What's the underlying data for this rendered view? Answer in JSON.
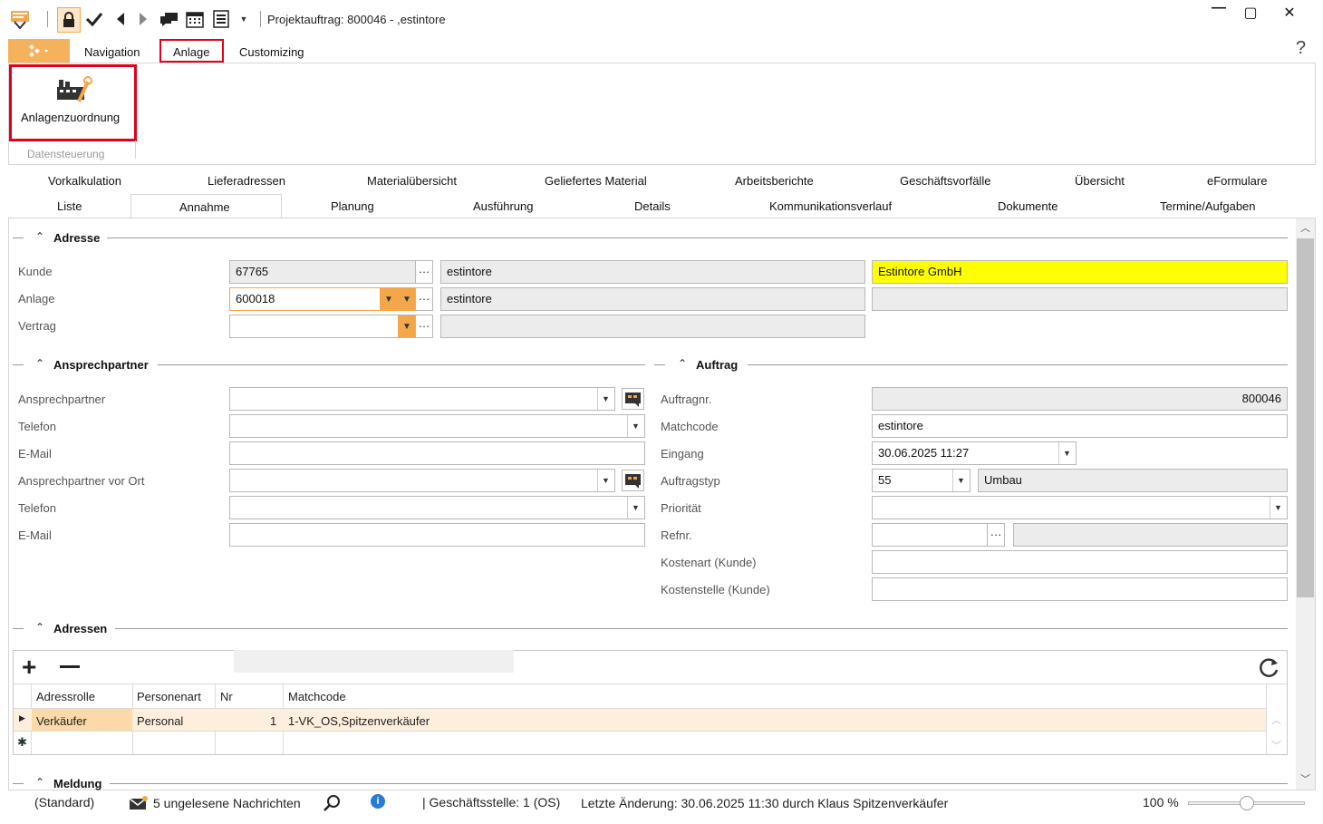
{
  "window": {
    "title": "Projektauftrag: 800046 - ,estintore",
    "minimize": "—",
    "maximize": "▢",
    "close": "✕"
  },
  "toolbar_icons": [
    "app-logo-icon",
    "lock-icon",
    "check-icon",
    "back-icon",
    "forward-icon",
    "chat-icon",
    "calendar-icon",
    "list-icon",
    "dropdown-icon"
  ],
  "menu": {
    "navigation": "Navigation",
    "anlage": "Anlage",
    "customizing": "Customizing",
    "help": "?"
  },
  "ribbon": {
    "button_label": "Anlagenzuordnung",
    "group_label": "Datensteuerung"
  },
  "tabs_row1": [
    "Vorkalkulation",
    "Lieferadressen",
    "Materialübersicht",
    "Geliefertes Material",
    "Arbeitsberichte",
    "Geschäftsvorfälle",
    "Übersicht",
    "eFormulare"
  ],
  "tabs_row2": [
    "Liste",
    "Annahme",
    "Planung",
    "Ausführung",
    "Details",
    "Kommunikationsverlauf",
    "Dokumente",
    "Termine/Aufgaben"
  ],
  "adresse": {
    "title": "Adresse",
    "kunde_label": "Kunde",
    "kunde_value": "67765",
    "kunde_match": "estintore",
    "kunde_name": "Estintore GmbH",
    "anlage_label": "Anlage",
    "anlage_value": "600018",
    "anlage_match": "estintore",
    "vertrag_label": "Vertrag"
  },
  "ansprechpartner": {
    "title": "Ansprechpartner",
    "labels": [
      "Ansprechpartner",
      "Telefon",
      "E-Mail",
      "Ansprechpartner vor Ort",
      "Telefon",
      "E-Mail"
    ]
  },
  "auftrag": {
    "title": "Auftrag",
    "auftragnr_label": "Auftragnr.",
    "auftragnr_value": "800046",
    "matchcode_label": "Matchcode",
    "matchcode_value": "estintore",
    "eingang_label": "Eingang",
    "eingang_value": "30.06.2025 11:27",
    "auftragstyp_label": "Auftragstyp",
    "auftragstyp_code": "55",
    "auftragstyp_name": "Umbau",
    "prioritaet_label": "Priorität",
    "refnr_label": "Refnr.",
    "kostenart_label": "Kostenart (Kunde)",
    "kostenstelle_label": "Kostenstelle (Kunde)"
  },
  "adressen": {
    "title": "Adressen",
    "columns": [
      "Adressrolle",
      "Personenart",
      "Nr",
      "Matchcode"
    ],
    "rows": [
      {
        "rolle": "Verkäufer",
        "art": "Personal",
        "nr": "1",
        "matchcode": "1-VK_OS,Spitzenverkäufer"
      }
    ]
  },
  "meldung": {
    "title": "Meldung"
  },
  "status": {
    "standard": "(Standard)",
    "messages": "5 ungelesene Nachrichten",
    "geschaeftsstelle": "| Geschäftsstelle:  1 (OS)",
    "letzte_aenderung": "Letzte Änderung: 30.06.2025 11:30 durch Klaus Spitzenverkäufer",
    "zoom": "100 %",
    "zoom_fraction": 0.5
  },
  "colors": {
    "accent_orange": "#f3a74a",
    "highlight_yellow": "#ffff00",
    "selected_row": "#fdefdc",
    "annotation_red": "#e0001a"
  }
}
